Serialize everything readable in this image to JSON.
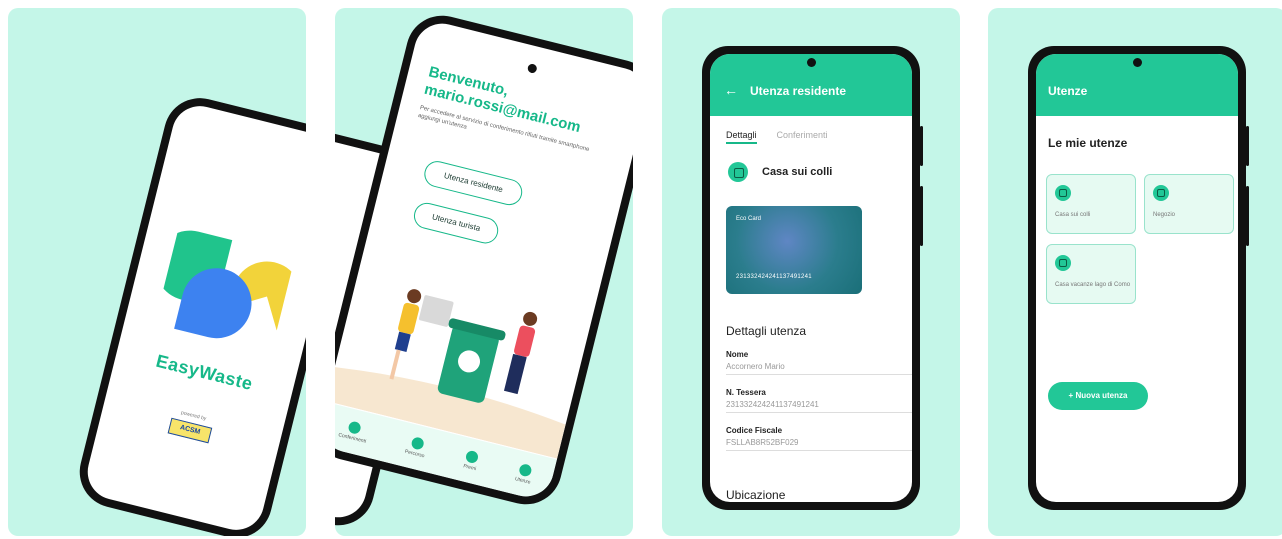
{
  "panel1": {
    "app_name": "EasyWaste",
    "powered_by": "powered by",
    "sponsor_logo": "ACSM"
  },
  "panel2": {
    "welcome_title": "Benvenuto,\nmario.rossi@mail.com",
    "welcome_text": "Per accedere al servizio di conferimento rifiuti tramite smartphone aggiungi un'utenza",
    "btn_resident": "Utenza residente",
    "btn_tourist": "Utenza turista",
    "nav": [
      "Conferimenti",
      "Percorso",
      "Premi",
      "Utenze"
    ]
  },
  "panel3": {
    "title": "Utenza residente",
    "tabs": [
      "Dettagli",
      "Conferimenti"
    ],
    "place": "Casa sui colli",
    "card_label": "Eco Card",
    "card_number": "231332424241137491241",
    "details_title": "Dettagli utenza",
    "fields": [
      {
        "label": "Nome",
        "value": "Accornero Mario"
      },
      {
        "label": "N. Tessera",
        "value": "231332424241137491241"
      },
      {
        "label": "Codice Fiscale",
        "value": "FSLLAB8R52BF029"
      }
    ],
    "location_title": "Ubicazione"
  },
  "panel4": {
    "title": "Utenze",
    "heading": "Le mie utenze",
    "tiles": [
      "Casa sui colli",
      "Negozio",
      "Casa vacanze lago di Como"
    ],
    "new_button": "+ Nuova utenza"
  },
  "colors": {
    "background": "#c4f6e8",
    "accent": "#22c797",
    "card": "#2b7d8d"
  }
}
